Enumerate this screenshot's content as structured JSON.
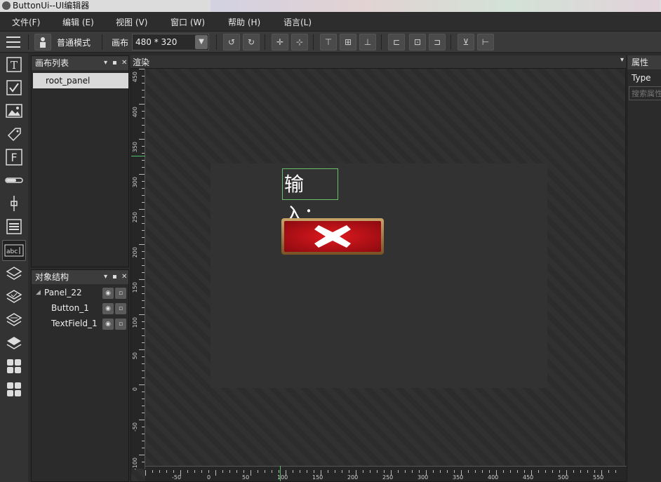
{
  "window": {
    "title": "ButtonUi--UI编辑器"
  },
  "menu": [
    {
      "label": "文件(F)"
    },
    {
      "label": "编辑 (E)"
    },
    {
      "label": "视图 (V)"
    },
    {
      "label": "窗口 (W)"
    },
    {
      "label": "帮助 (H)"
    },
    {
      "label": "语言(L)"
    }
  ],
  "toolbar": {
    "mode_label": "普通模式",
    "canvas_label": "画布",
    "canvas_size": "480 * 320"
  },
  "canvas_list": {
    "title": "画布列表",
    "items": [
      {
        "label": "root_panel",
        "selected": true
      }
    ]
  },
  "object_tree": {
    "title": "对象结构",
    "items": [
      {
        "label": "Panel_22",
        "expanded": true
      },
      {
        "label": "Button_1"
      },
      {
        "label": "TextField_1"
      }
    ]
  },
  "render": {
    "title": "渲染",
    "textfield_text": "输入：",
    "ruler_h": [
      "-50",
      "0",
      "50",
      "100",
      "150",
      "200",
      "250",
      "300",
      "350",
      "400",
      "450",
      "500",
      "550"
    ],
    "ruler_v": [
      "450",
      "400",
      "350",
      "300",
      "250",
      "200",
      "150",
      "100",
      "50",
      "0",
      "-50",
      "-100"
    ]
  },
  "properties": {
    "title": "属性",
    "type_label": "Type",
    "search_placeholder": "搜索属性"
  },
  "colors": {
    "accent": "#6bbf6b",
    "button_red": "#d0141a"
  }
}
